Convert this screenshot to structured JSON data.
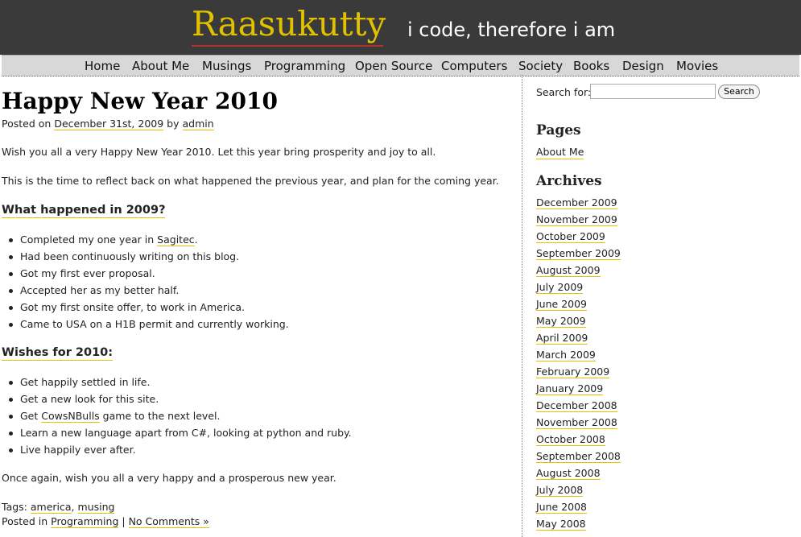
{
  "header": {
    "site_title": "Raasukutty",
    "tagline": "i code, therefore i am"
  },
  "nav": [
    "Home",
    "About Me",
    "Musings",
    "Programming",
    "Open Source",
    "Computers",
    "Society",
    "Books",
    "Design",
    "Movies"
  ],
  "post": {
    "title": "Happy New Year 2010",
    "posted_on_prefix": "Posted on",
    "date": "December 31st, 2009",
    "by": "by",
    "author": "admin",
    "para1": "Wish you all a very Happy New Year 2010. Let this year bring prosperity and joy to all.",
    "para2": "This is the time to reflect back on what happened the previous year, and plan for the coming year.",
    "heading1": "What happened in 2009?",
    "list1": {
      "item1_pre": "Completed my one year in ",
      "item1_link": "Sagitec",
      "item1_post": ".",
      "item2": "Had been continuously writing on this blog.",
      "item3": "Got my first ever proposal.",
      "item4": "Accepted her as my better half.",
      "item5": "Got my first onsite offer, to work in America.",
      "item6": "Came to USA on a H1B permit and currently working."
    },
    "heading2": "Wishes for 2010:",
    "list2": {
      "item1": "Get happily settled in life.",
      "item2": "Get a new look for this site.",
      "item3_pre": "Get ",
      "item3_link": "CowsNBulls",
      "item3_post": " game to the next level.",
      "item4": "Learn a new language apart from C#, looking at python and ruby.",
      "item5": "Live happily ever after."
    },
    "para3": "Once again, wish you all a very happy and a prosperous new year.",
    "tags_label": "Tags:",
    "tag1": "america",
    "tag_sep": ",",
    "tag2": "musing",
    "posted_in_label": "Posted in",
    "category": "Programming",
    "pipe": "|",
    "comments": "No Comments »"
  },
  "sidebar": {
    "search_label": "Search for:",
    "search_value": "",
    "search_button": "Search",
    "pages_heading": "Pages",
    "pages_link": "About Me",
    "archives_heading": "Archives",
    "archives": [
      "December 2009",
      "November 2009",
      "October 2009",
      "September 2009",
      "August 2009",
      "July 2009",
      "June 2009",
      "May 2009",
      "April 2009",
      "March 2009",
      "February 2009",
      "January 2009",
      "December 2008",
      "November 2008",
      "October 2008",
      "September 2008",
      "August 2008",
      "July 2008",
      "June 2008",
      "May 2008"
    ]
  },
  "colors": {
    "header_bg": "#3a3a3a",
    "title_yellow": "#e2c200",
    "nav_bg": "#d8d8d8",
    "link_underline": "#e2c200"
  }
}
